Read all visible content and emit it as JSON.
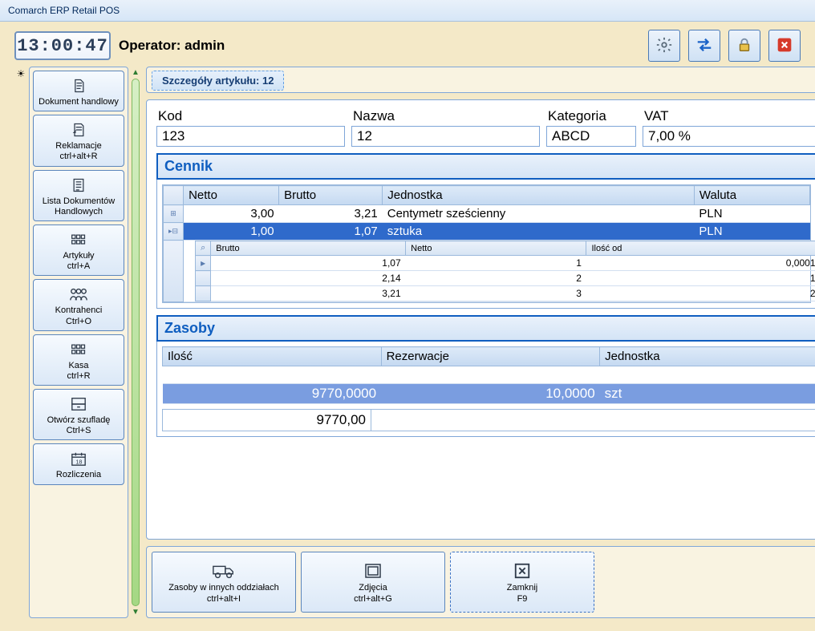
{
  "window_title": "Comarch ERP Retail POS",
  "clock": "13:00:47",
  "operator_label": "Operator: admin",
  "tab_title": "Szczegóły artykułu: 12",
  "fields": {
    "kod": {
      "label": "Kod",
      "value": "123"
    },
    "nazwa": {
      "label": "Nazwa",
      "value": "12"
    },
    "kategoria": {
      "label": "Kategoria",
      "value": "ABCD"
    },
    "vat": {
      "label": "VAT",
      "value": "7,00 %"
    }
  },
  "sidebar": [
    {
      "label": "Dokument handlowy"
    },
    {
      "label": "Reklamacje\nctrl+alt+R"
    },
    {
      "label": "Lista Dokumentów Handlowych"
    },
    {
      "label": "Artykuły\nctrl+A"
    },
    {
      "label": "Kontrahenci\nCtrl+O"
    },
    {
      "label": "Kasa\nctrl+R"
    },
    {
      "label": "Otwórz szufladę\nCtrl+S"
    },
    {
      "label": "Rozliczenia"
    }
  ],
  "cennik": {
    "title": "Cennik",
    "headers": {
      "netto": "Netto",
      "brutto": "Brutto",
      "jedn": "Jednostka",
      "waluta": "Waluta"
    },
    "rows": [
      {
        "netto": "3,00",
        "brutto": "3,21",
        "jedn": "Centymetr sześcienny",
        "waluta": "PLN",
        "selected": false
      },
      {
        "netto": "1,00",
        "brutto": "1,07",
        "jedn": "sztuka",
        "waluta": "PLN",
        "selected": true
      }
    ],
    "sub_headers": {
      "brutto": "Brutto",
      "netto": "Netto",
      "ilosc": "Ilość od"
    },
    "sub_rows": [
      {
        "brutto": "1,07",
        "netto": "1",
        "ilosc": "0,0001"
      },
      {
        "brutto": "2,14",
        "netto": "2",
        "ilosc": "1"
      },
      {
        "brutto": "3,21",
        "netto": "3",
        "ilosc": "2"
      }
    ]
  },
  "zasoby": {
    "title": "Zasoby",
    "headers": {
      "ilosc": "Ilość",
      "rez": "Rezerwacje",
      "jedn": "Jednostka"
    },
    "row": {
      "ilosc": "9770,0000",
      "rez": "10,0000",
      "jedn": "szt"
    },
    "total": "9770,00"
  },
  "bottom": [
    {
      "label": "Zasoby w innych oddziałach",
      "shortcut": "ctrl+alt+I"
    },
    {
      "label": "Zdjęcia",
      "shortcut": "ctrl+alt+G"
    },
    {
      "label": "Zamknij",
      "shortcut": "F9"
    }
  ]
}
